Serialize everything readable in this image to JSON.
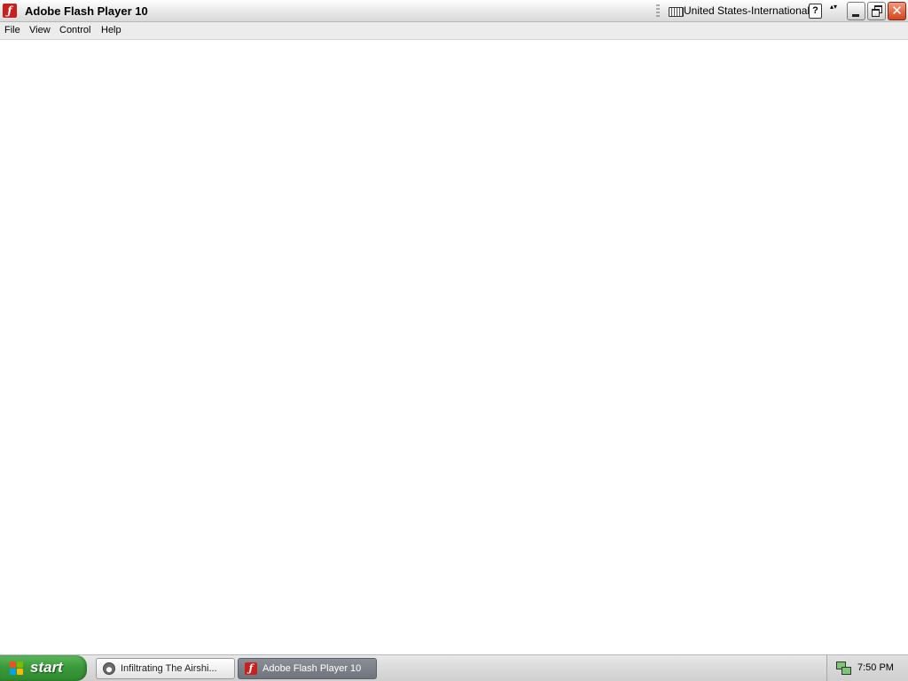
{
  "window": {
    "title": "Adobe Flash Player 10",
    "app_icon": "flash-player-icon",
    "close_glyph": "✕"
  },
  "language_bar": {
    "language": "United States-International",
    "help_glyph": "?",
    "options_glyph": "▴▾",
    "keyboard_icon": "keyboard-icon"
  },
  "menu": {
    "file": "File",
    "view": "View",
    "control": "Control",
    "help": "Help"
  },
  "taskbar": {
    "start_label": "start",
    "tasks": [
      {
        "label": "Infiltrating The Airshi...",
        "icon": "raccoon-app-icon",
        "active": false
      },
      {
        "label": "Adobe Flash Player 10",
        "icon": "flash-player-icon",
        "active": true
      }
    ],
    "clock": "7:50 PM",
    "tray_icon": "network-icon"
  },
  "colors": {
    "start_green": "#3a9a3a",
    "close_red": "#d3451f",
    "flash_red": "#c8201d",
    "active_task": "#7a7f87"
  }
}
